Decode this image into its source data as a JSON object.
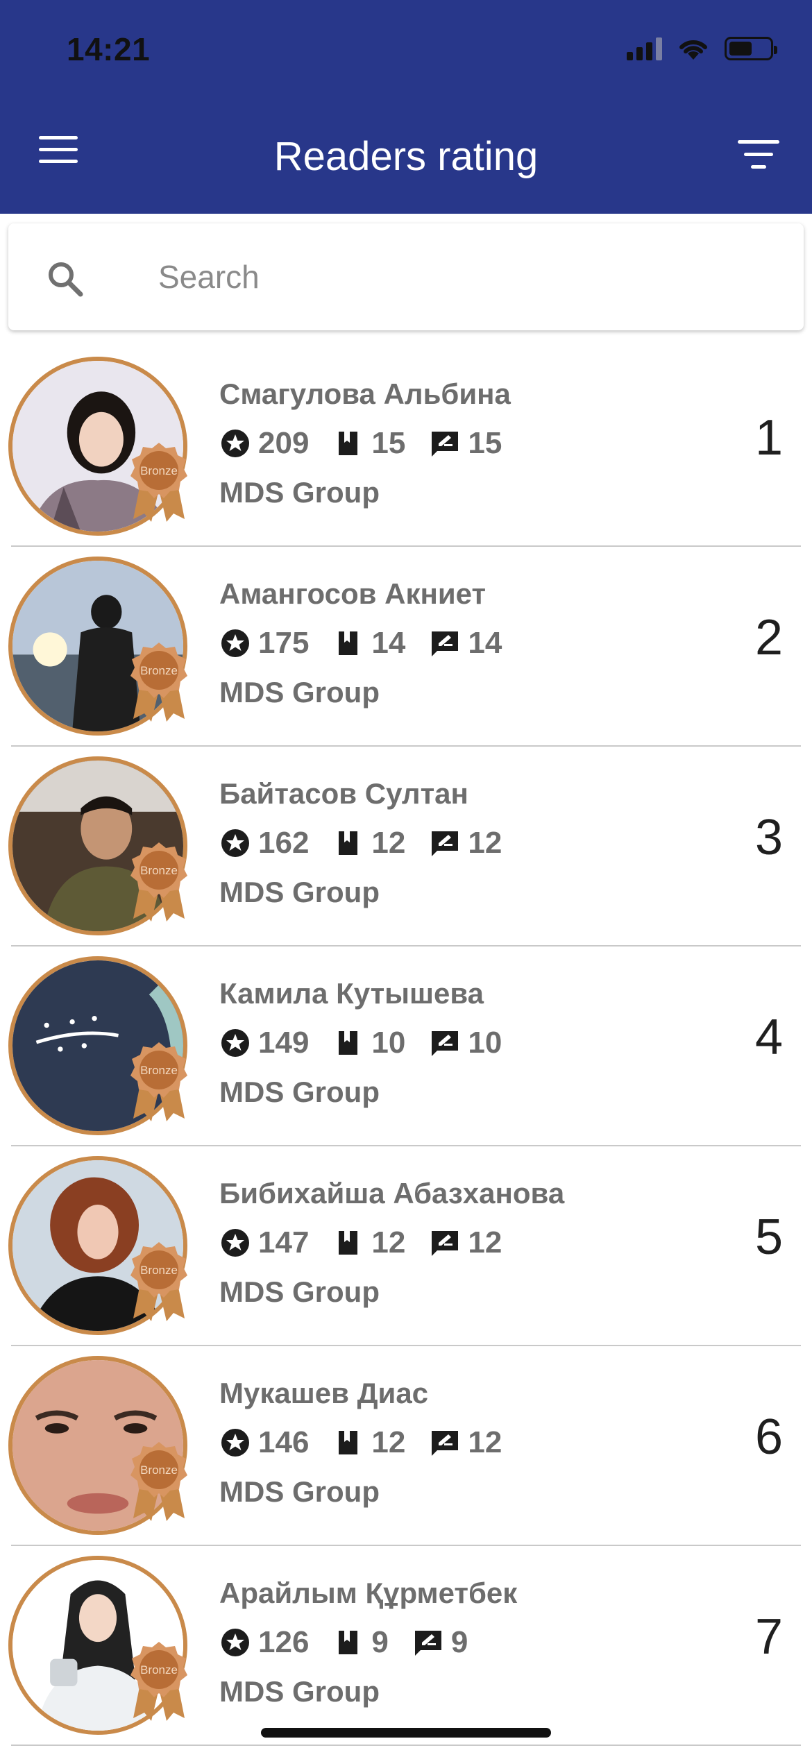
{
  "status_bar": {
    "time": "14:21"
  },
  "header": {
    "title": "Readers rating"
  },
  "search": {
    "placeholder": "Search"
  },
  "medal_label": "Bronze",
  "rows": [
    {
      "name": "Смагулова Альбина",
      "points": "209",
      "books": "15",
      "reviews": "15",
      "group": "MDS Group",
      "rank": "1"
    },
    {
      "name": "Амангосов Акниет",
      "points": "175",
      "books": "14",
      "reviews": "14",
      "group": "MDS Group",
      "rank": "2"
    },
    {
      "name": "Байтасов Султан",
      "points": "162",
      "books": "12",
      "reviews": "12",
      "group": "MDS Group",
      "rank": "3"
    },
    {
      "name": "Камила Кутышева",
      "points": "149",
      "books": "10",
      "reviews": "10",
      "group": "MDS Group",
      "rank": "4"
    },
    {
      "name": "Бибихайша Абазханова",
      "points": "147",
      "books": "12",
      "reviews": "12",
      "group": "MDS Group",
      "rank": "5"
    },
    {
      "name": "Мукашев Диас",
      "points": "146",
      "books": "12",
      "reviews": "12",
      "group": "MDS Group",
      "rank": "6"
    },
    {
      "name": "Арайлым Құрметбек",
      "points": "126",
      "books": "9",
      "reviews": "9",
      "group": "MDS Group",
      "rank": "7"
    }
  ],
  "colors": {
    "header": "#28378a",
    "medal": "#c98a4a",
    "text_muted": "#6d6d6d"
  }
}
